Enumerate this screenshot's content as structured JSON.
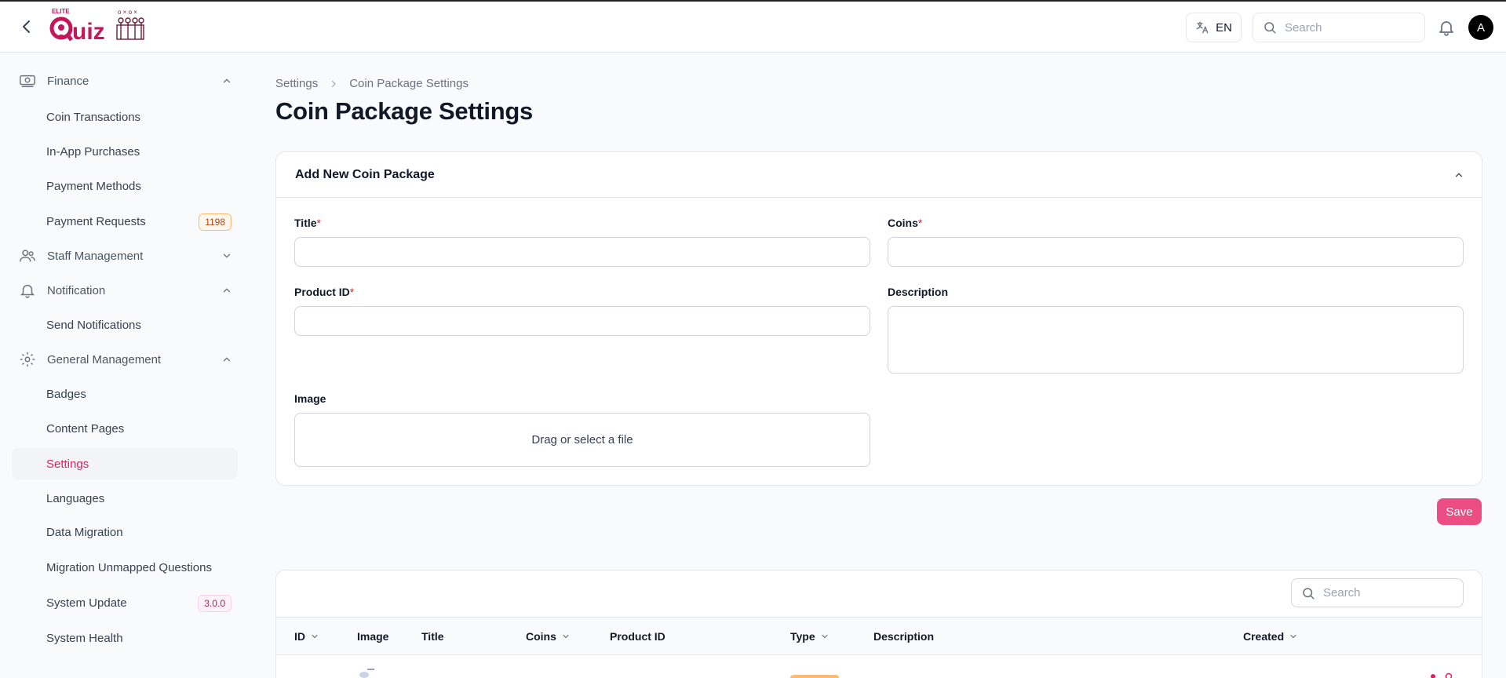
{
  "header": {
    "logo": {
      "small_text": "ELITE",
      "brand": "Quiz"
    },
    "lang_label": "EN",
    "search_placeholder": "Search",
    "avatar_initial": "A",
    "icons": [
      "chevron-left-icon",
      "translate-icon",
      "search-icon",
      "bell-icon"
    ]
  },
  "sidebar": {
    "groups": {
      "finance": {
        "label": "Finance",
        "icon": "money-icon",
        "expanded": true
      },
      "staff": {
        "label": "Staff Management",
        "icon": "users-icon",
        "expanded": false
      },
      "notification": {
        "label": "Notification",
        "icon": "bell-icon",
        "expanded": true
      },
      "general": {
        "label": "General Management",
        "icon": "gear-icon",
        "expanded": true
      }
    },
    "finance_items": [
      {
        "label": "Coin Transactions"
      },
      {
        "label": "In-App Purchases"
      },
      {
        "label": "Payment Methods"
      },
      {
        "label": "Payment Requests",
        "badge": "1198"
      }
    ],
    "notification_items": [
      {
        "label": "Send Notifications"
      }
    ],
    "general_items": [
      {
        "label": "Badges"
      },
      {
        "label": "Content Pages"
      },
      {
        "label": "Settings",
        "active": true
      },
      {
        "label": "Languages"
      },
      {
        "label": "Data Migration"
      },
      {
        "label": "Migration Unmapped Questions"
      },
      {
        "label": "System Update",
        "badge": "3.0.0"
      },
      {
        "label": "System Health"
      }
    ]
  },
  "breadcrumb": [
    "Settings",
    "Coin Package Settings"
  ],
  "page_title": "Coin Package Settings",
  "form": {
    "section_title": "Add New Coin Package",
    "title_label": "Title",
    "coins_label": "Coins",
    "product_id_label": "Product ID",
    "description_label": "Description",
    "image_label": "Image",
    "required_mark": "*",
    "dropzone_text": "Drag or select a file",
    "title_value": "",
    "coins_value": "",
    "product_id_value": "",
    "description_value": ""
  },
  "save_label": "Save",
  "table": {
    "search_placeholder": "Search",
    "columns": [
      {
        "label": "ID",
        "sortable": true
      },
      {
        "label": "Image",
        "sortable": false
      },
      {
        "label": "Title",
        "sortable": false
      },
      {
        "label": "Coins",
        "sortable": true
      },
      {
        "label": "Product ID",
        "sortable": false
      },
      {
        "label": "Type",
        "sortable": true
      },
      {
        "label": "Description",
        "sortable": false
      },
      {
        "label": "Created",
        "sortable": true
      }
    ]
  },
  "colors": {
    "accent": "#ec4d83",
    "active_text": "#e11d62",
    "required": "#dc2626"
  }
}
